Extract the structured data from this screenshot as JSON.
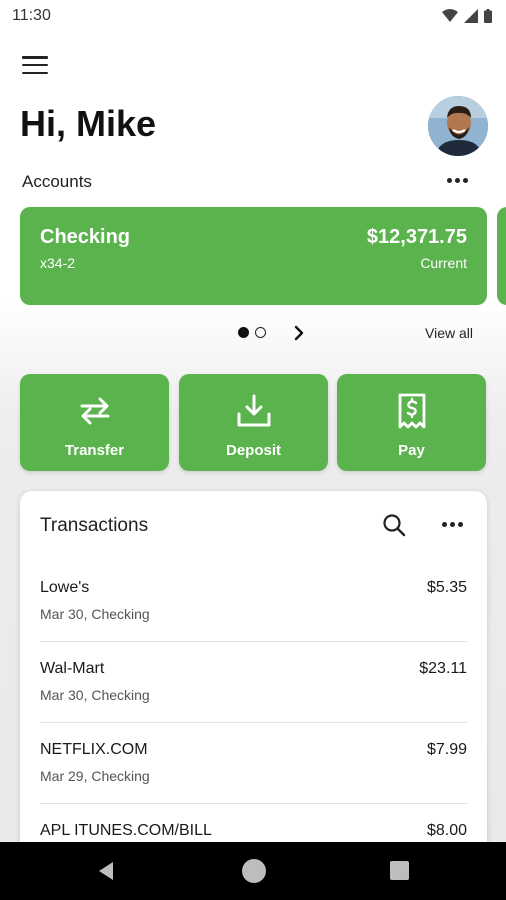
{
  "status_bar": {
    "time": "11:30"
  },
  "header": {
    "greeting": "Hi, Mike"
  },
  "accounts": {
    "section_label": "Accounts",
    "cards": [
      {
        "name": "Checking",
        "number": "x34-2",
        "balance": "$12,371.75",
        "balance_type": "Current"
      }
    ],
    "view_all_label": "View all"
  },
  "actions": [
    {
      "label": "Transfer",
      "icon": "transfer-arrows-icon"
    },
    {
      "label": "Deposit",
      "icon": "download-tray-icon"
    },
    {
      "label": "Pay",
      "icon": "receipt-dollar-icon"
    }
  ],
  "transactions": {
    "title": "Transactions",
    "items": [
      {
        "merchant": "Lowe's",
        "meta": "Mar 30, Checking",
        "amount": "$5.35"
      },
      {
        "merchant": "Wal-Mart",
        "meta": "Mar 30, Checking",
        "amount": "$23.11"
      },
      {
        "merchant": "NETFLIX.COM",
        "meta": "Mar 29, Checking",
        "amount": "$7.99"
      },
      {
        "merchant": "APL ITUNES.COM/BILL",
        "meta": "",
        "amount": "$8.00"
      }
    ]
  },
  "colors": {
    "accent": "#5ab34c",
    "nav_bar": "#000000"
  }
}
